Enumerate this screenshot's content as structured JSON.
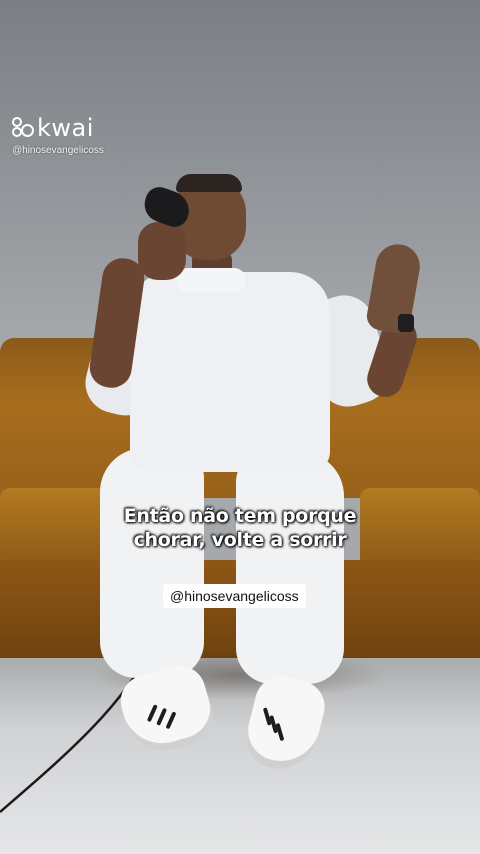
{
  "watermark": {
    "brand": "kwai",
    "handle": "@hinosevangelicoss",
    "logo_icon": "kwai-logo-icon"
  },
  "caption": {
    "line1": "Então não tem porque",
    "line2": "chorar, volte a sorrir"
  },
  "tag": {
    "label": "@hinosevangelicoss"
  },
  "colors": {
    "background_wall": "#9a9da1",
    "sofa": "#a86d1e",
    "caption_text": "#ffffff",
    "tag_background": "#ffffff"
  }
}
